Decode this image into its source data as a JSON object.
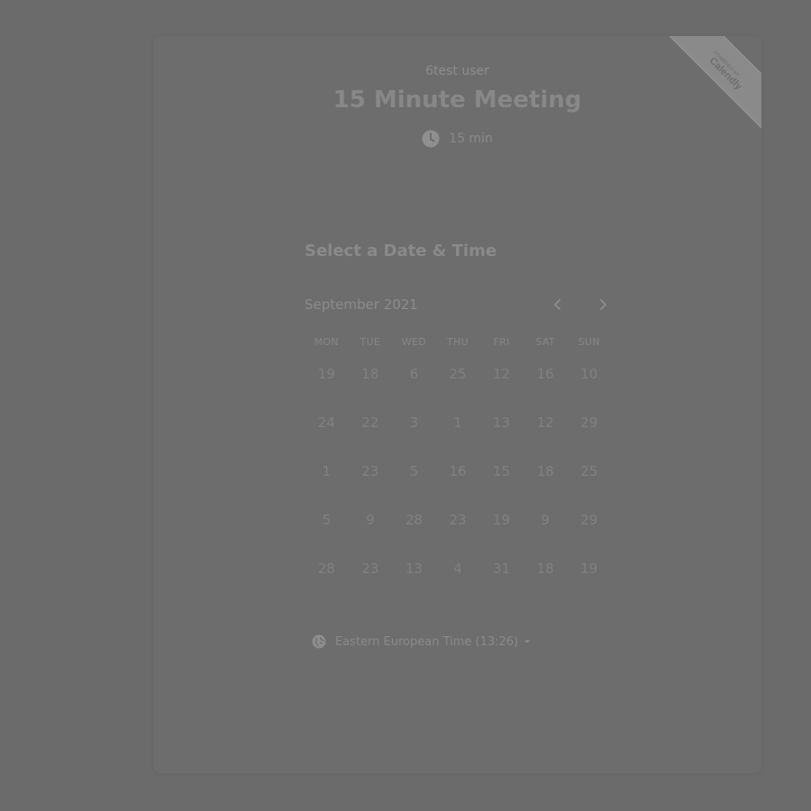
{
  "header": {
    "owner_name": "6test user",
    "event_title": "15 Minute Meeting",
    "duration": "15 min"
  },
  "badge": {
    "line1": "POWERED BY",
    "line2": "Calendly"
  },
  "scheduler": {
    "heading": "Select a Date & Time",
    "month": "September 2021",
    "weekdays": [
      "MON",
      "TUE",
      "WED",
      "THU",
      "FRI",
      "SAT",
      "SUN"
    ],
    "weeks": [
      [
        "19",
        "18",
        "6",
        "25",
        "12",
        "16",
        "10"
      ],
      [
        "24",
        "22",
        "3",
        "1",
        "13",
        "12",
        "29"
      ],
      [
        "1",
        "23",
        "5",
        "16",
        "15",
        "18",
        "25"
      ],
      [
        "5",
        "9",
        "28",
        "23",
        "19",
        "9",
        "29"
      ],
      [
        "28",
        "23",
        "13",
        "4",
        "31",
        "18",
        "19"
      ]
    ]
  },
  "timezone": {
    "label": "Eastern European Time (13:26)"
  }
}
